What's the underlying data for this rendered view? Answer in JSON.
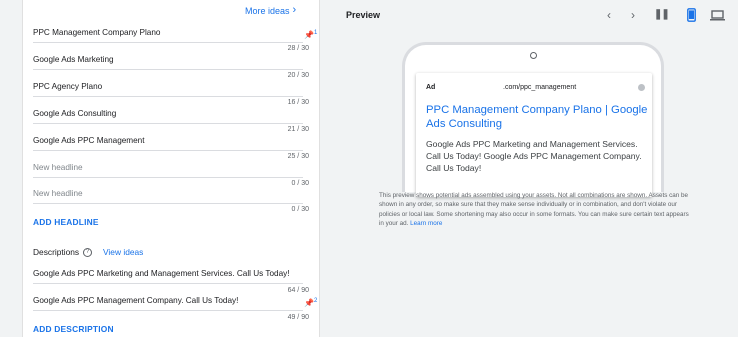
{
  "editor": {
    "more_ideas": "More ideas",
    "headlines": [
      {
        "text": "PPC Management Company Plano",
        "count": "28 / 30",
        "placeholder": false
      },
      {
        "text": "Google Ads Marketing",
        "count": "20 / 30",
        "placeholder": false
      },
      {
        "text": "PPC Agency Plano",
        "count": "16 / 30",
        "placeholder": false
      },
      {
        "text": "Google Ads Consulting",
        "count": "21 / 30",
        "placeholder": false
      },
      {
        "text": "Google Ads PPC Management",
        "count": "25 / 30",
        "placeholder": false
      },
      {
        "text": "New headline",
        "count": "0 / 30",
        "placeholder": true
      },
      {
        "text": "New headline",
        "count": "0 / 30",
        "placeholder": true
      }
    ],
    "headline_pin_number": "1",
    "add_headline": "ADD HEADLINE",
    "descriptions_label": "Descriptions",
    "view_ideas": "View ideas",
    "descriptions": [
      {
        "text": "Google Ads PPC Marketing and Management Services. Call Us Today!",
        "count": "64 / 90"
      },
      {
        "text": "Google Ads PPC Management Company. Call Us Today!",
        "count": "49 / 90"
      }
    ],
    "description_pin_number": "2",
    "add_description": "ADD DESCRIPTION"
  },
  "preview": {
    "title": "Preview",
    "ad_badge": "Ad",
    "display_url": ".com/ppc_management",
    "headline": "PPC Management Company Plano | Google Ads Consulting",
    "description": "Google Ads PPC Marketing and Management Services. Call Us Today! Google Ads PPC Management Company. Call Us Today!",
    "disclaimer": "This preview shows potential ads assembled using your assets. Not all combinations are shown. Assets can be shown in any order, so make sure that they make sense individually or in combination, and don't violate our policies or local law. Some shortening may also occur in some formats. You can make sure certain text appears in your ad.",
    "learn_more": "Learn more",
    "active_device": "mobile"
  },
  "colors": {
    "accent": "#1a73e8",
    "background": "#f1f3f4"
  }
}
